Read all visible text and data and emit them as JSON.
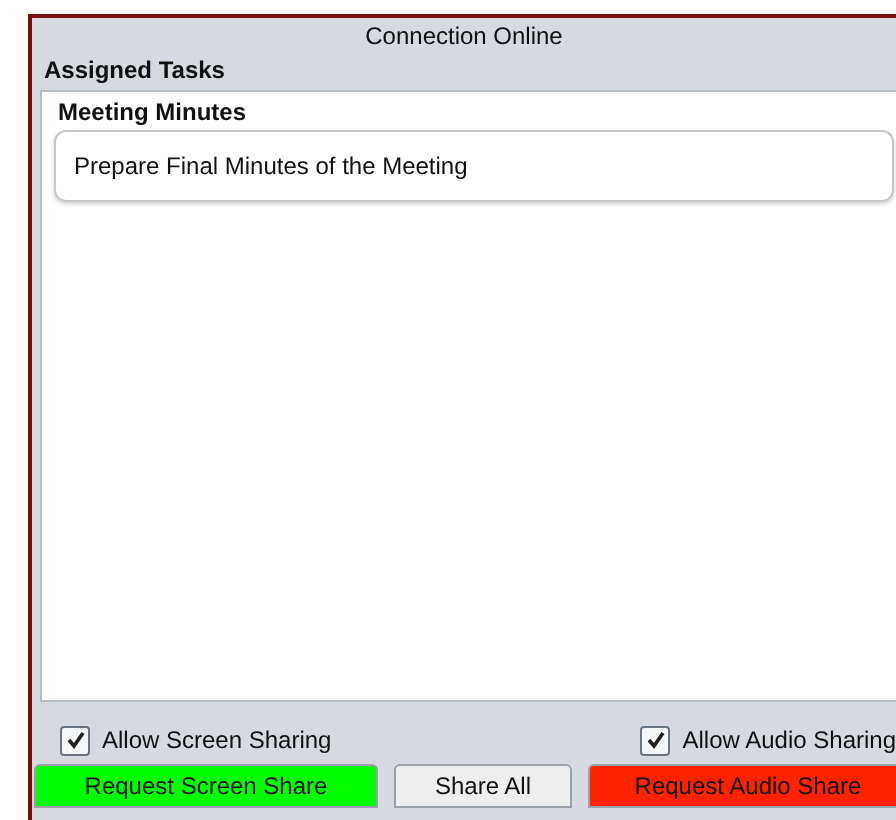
{
  "status": "Connection Online",
  "section_title": "Assigned Tasks",
  "task_group": {
    "title": "Meeting Minutes",
    "tasks": [
      "Prepare Final Minutes of the Meeting"
    ]
  },
  "options": [
    {
      "label": "Allow Screen Sharing",
      "checked": true
    },
    {
      "label": "Allow Audio Sharing",
      "checked": true
    }
  ],
  "buttons": [
    {
      "label": "Request Screen Share",
      "color": "#00ff00"
    },
    {
      "label": "Share All",
      "color": "#eeeeee"
    },
    {
      "label": "Request Audio Share",
      "color": "#ff2200"
    }
  ]
}
